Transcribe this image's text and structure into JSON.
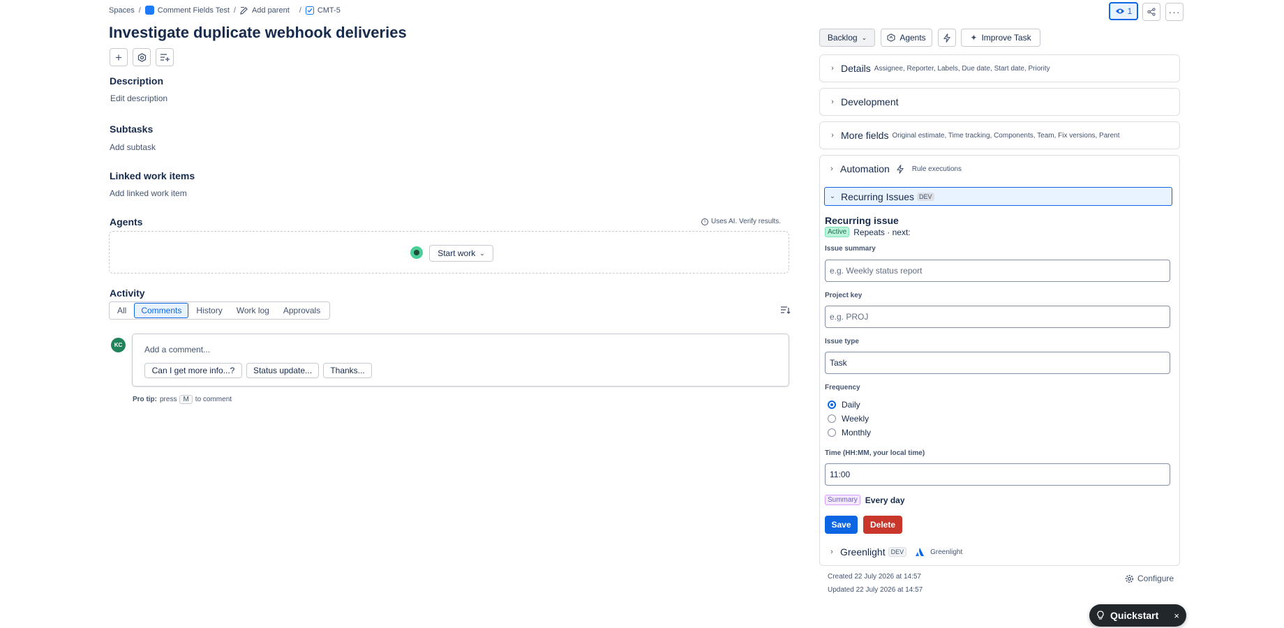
{
  "breadcrumb": {
    "spaces": "Spaces",
    "project": "Comment Fields Test",
    "add_parent": "Add parent",
    "issue_key": "CMT-5"
  },
  "header": {
    "watch_count": "1"
  },
  "issue": {
    "title": "Investigate duplicate webhook deliveries"
  },
  "description": {
    "heading": "Description",
    "placeholder": "Edit description"
  },
  "subtasks": {
    "heading": "Subtasks",
    "action": "Add subtask"
  },
  "linked": {
    "heading": "Linked work items",
    "action": "Add linked work item"
  },
  "agents": {
    "heading": "Agents",
    "ai_note": "Uses AI. Verify results.",
    "start_work": "Start work"
  },
  "activity": {
    "heading": "Activity",
    "tabs": [
      "All",
      "Comments",
      "History",
      "Work log",
      "Approvals"
    ],
    "active_tab": "Comments",
    "avatar_initials": "KC",
    "comment_placeholder": "Add a comment...",
    "suggestions": [
      "Can I get more info...?",
      "Status update...",
      "Thanks..."
    ],
    "pro_tip_label": "Pro tip:",
    "pro_tip_pre": "press",
    "pro_tip_key": "M",
    "pro_tip_post": "to comment"
  },
  "toolbar": {
    "status": "Backlog",
    "agents": "Agents",
    "improve": "Improve Task"
  },
  "panels": {
    "details": {
      "title": "Details",
      "meta": "Assignee, Reporter, Labels, Due date, Start date, Priority"
    },
    "development": {
      "title": "Development"
    },
    "more_fields": {
      "title": "More fields",
      "meta": "Original estimate, Time tracking, Components, Team, Fix versions, Parent"
    },
    "automation": {
      "title": "Automation",
      "meta": "Rule executions"
    },
    "recurring": {
      "title": "Recurring Issues",
      "badge": "DEV",
      "section_title": "Recurring issue",
      "status_badge": "Active",
      "repeats": "Repeats · next:",
      "summary_label": "Issue summary",
      "summary_placeholder": "e.g. Weekly status report",
      "project_label": "Project key",
      "project_placeholder": "e.g. PROJ",
      "type_label": "Issue type",
      "type_value": "Task",
      "frequency_label": "Frequency",
      "frequency_options": [
        "Daily",
        "Weekly",
        "Monthly"
      ],
      "frequency_selected": "Daily",
      "time_label": "Time (HH:MM, your local time)",
      "time_value": "11:00",
      "summary_badge": "Summary",
      "summary_text": "Every day",
      "save": "Save",
      "delete": "Delete"
    },
    "greenlight": {
      "title": "Greenlight",
      "badge": "DEV",
      "meta": "Greenlight"
    }
  },
  "footer": {
    "created": "Created 22 July 2026 at 14:57",
    "updated": "Updated 22 July 2026 at 14:57",
    "configure": "Configure"
  },
  "quickstart": {
    "label": "Quickstart"
  },
  "colors": {
    "primary": "#0c66e4",
    "danger": "#c9372c",
    "success_badge": "#baf3db",
    "summary_badge": "#f3e8fd"
  }
}
